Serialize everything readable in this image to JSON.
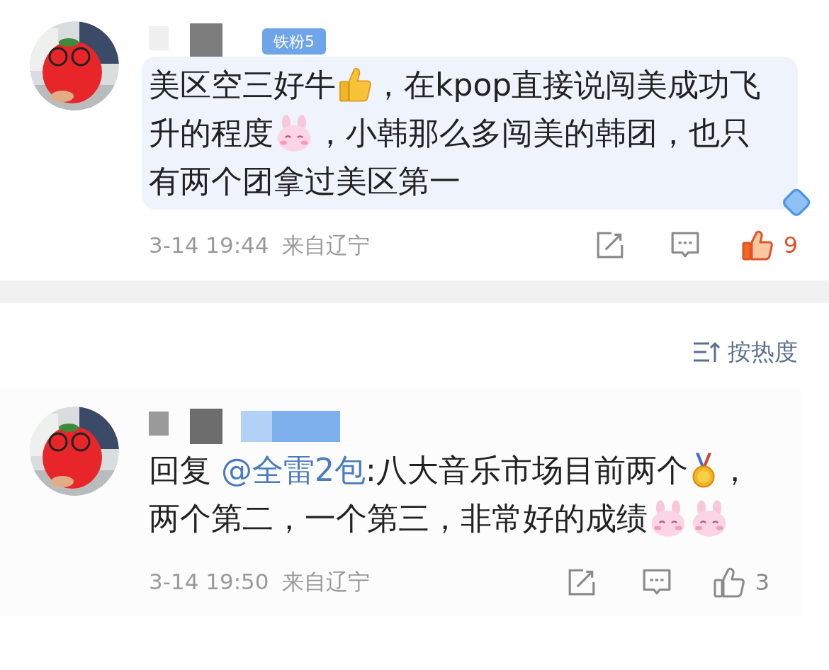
{
  "comments": [
    {
      "badge": "铁粉5",
      "highlighted": true,
      "content": [
        {
          "kind": "text",
          "text": "美区空三好牛"
        },
        {
          "kind": "thumbs"
        },
        {
          "kind": "text",
          "text": "，在kpop直接说闯美成功飞升的程度"
        },
        {
          "kind": "bunny"
        },
        {
          "kind": "text",
          "text": "，小韩那么多闯美的韩团，也只有两个团拿过美区第一"
        }
      ],
      "time": "3-14 19:44",
      "location": "来自辽宁",
      "liked": true,
      "likes": "9"
    },
    {
      "highlighted": false,
      "content": [
        {
          "kind": "text",
          "text": "回复 "
        },
        {
          "kind": "mention",
          "text": "@全雷2包"
        },
        {
          "kind": "text",
          "text": ":八大音乐市场目前两个"
        },
        {
          "kind": "medal"
        },
        {
          "kind": "text",
          "text": "，两个第二，一个第三，非常好的成绩"
        },
        {
          "kind": "bunny"
        },
        {
          "kind": "bunny"
        }
      ],
      "time": "3-14 19:50",
      "location": "来自辽宁",
      "liked": false,
      "likes": "3"
    }
  ],
  "sort": {
    "label": "按热度"
  }
}
